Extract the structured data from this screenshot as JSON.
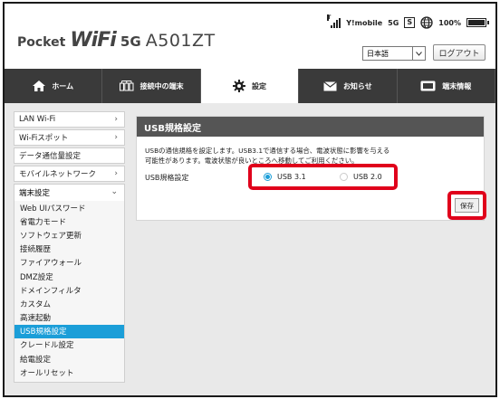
{
  "header": {
    "logo": {
      "pocket": "Pocket",
      "wifi": "WiFi",
      "fiveg": "5G",
      "model": "A501ZT"
    },
    "status": {
      "signal_icon": "signal-bars-icon",
      "carrier": "Y!mobile",
      "network": "5G",
      "sim_badge": "S",
      "battery_percent": "100%",
      "battery_level": 1.0
    },
    "language": {
      "selected": "日本語"
    },
    "logout_label": "ログアウト"
  },
  "nav": {
    "tabs": [
      {
        "label": "ホーム",
        "icon": "home-icon",
        "active": false
      },
      {
        "label": "接続中の端末",
        "icon": "devices-icon",
        "active": false
      },
      {
        "label": "設定",
        "icon": "gear-icon",
        "active": true
      },
      {
        "label": "お知らせ",
        "icon": "mail-icon",
        "active": false
      },
      {
        "label": "端末情報",
        "icon": "device-info-icon",
        "active": false
      }
    ]
  },
  "sidebar": {
    "items": [
      {
        "label": "LAN Wi-Fi",
        "chevron": "›"
      },
      {
        "label": "Wi-Fiスポット",
        "chevron": "›"
      },
      {
        "label": "データ通信量設定",
        "chevron": ""
      },
      {
        "label": "モバイルネットワーク",
        "chevron": "›"
      }
    ],
    "group": {
      "label": "端末設定",
      "chevron": "⌄",
      "items": [
        {
          "label": "Web UIパスワード",
          "active": false
        },
        {
          "label": "省電力モード",
          "active": false
        },
        {
          "label": "ソフトウェア更新",
          "active": false
        },
        {
          "label": "接続履歴",
          "active": false
        },
        {
          "label": "ファイアウォール",
          "active": false
        },
        {
          "label": "DMZ設定",
          "active": false
        },
        {
          "label": "ドメインフィルタ",
          "active": false
        },
        {
          "label": "カスタム",
          "active": false
        },
        {
          "label": "高速起動",
          "active": false
        },
        {
          "label": "USB規格設定",
          "active": true
        },
        {
          "label": "クレードル設定",
          "active": false
        },
        {
          "label": "給電設定",
          "active": false
        },
        {
          "label": "オールリセット",
          "active": false
        }
      ]
    }
  },
  "panel": {
    "title": "USB規格設定",
    "description_line1": "USBの通信規格を設定します。USB3.1で通信する場合、電波状態に影響を与える",
    "description_line2": "可能性があります。電波状態が良いところへ移動してご利用ください。",
    "field_label": "USB規格設定",
    "options": [
      {
        "label": "USB 3.1",
        "selected": true
      },
      {
        "label": "USB 2.0",
        "selected": false
      }
    ],
    "save_label": "保存"
  },
  "colors": {
    "accent": "#1b9ed8",
    "nav_bg": "#3a3a3a",
    "panel_title_bg": "#555555",
    "highlight": "#e0001b"
  }
}
